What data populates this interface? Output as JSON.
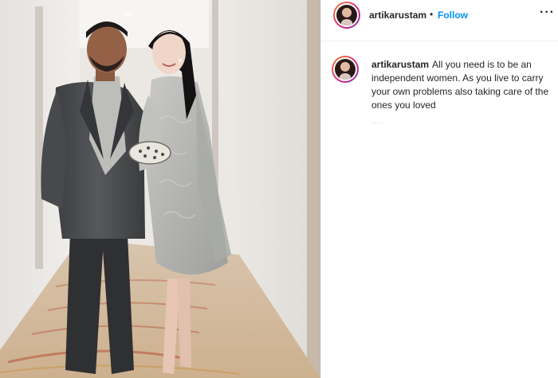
{
  "post": {
    "username": "artikarustam",
    "separator": "•",
    "follow_label": "Follow",
    "more_label": "···",
    "caption_text": "All you need is to be an independent women. As you live to carry your own problems also taking care of the ones you loved"
  },
  "icons": {
    "avatar": "profile-avatar",
    "more": "more-options-icon"
  },
  "colors": {
    "follow": "#0095f6",
    "text": "#262626",
    "divider": "#efefef"
  }
}
